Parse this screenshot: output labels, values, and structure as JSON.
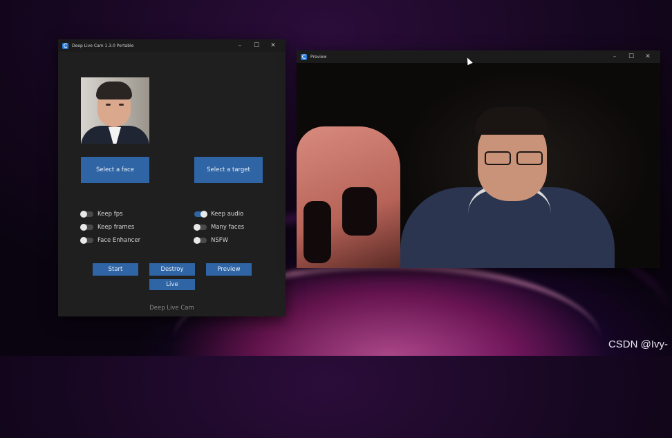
{
  "app_window": {
    "title": "Deep Live Cam 1.3.0 Portable",
    "controls": {
      "minimize": "–",
      "maximize": "☐",
      "close": "✕"
    },
    "select_face_label": "Select a face",
    "select_target_label": "Select a target",
    "toggles_left": [
      {
        "label": "Keep fps",
        "on": false
      },
      {
        "label": "Keep frames",
        "on": false
      },
      {
        "label": "Face Enhancer",
        "on": false
      }
    ],
    "toggles_right": [
      {
        "label": "Keep audio",
        "on": true
      },
      {
        "label": "Many faces",
        "on": false
      },
      {
        "label": "NSFW",
        "on": false
      }
    ],
    "buttons": {
      "start": "Start",
      "destroy": "Destroy",
      "preview": "Preview",
      "live": "Live"
    },
    "footer": "Deep Live Cam",
    "accent_color": "#2f65a5"
  },
  "preview_window": {
    "title": "Preview",
    "controls": {
      "minimize": "–",
      "maximize": "☐",
      "close": "✕"
    }
  },
  "watermark": "CSDN @Ivy-"
}
